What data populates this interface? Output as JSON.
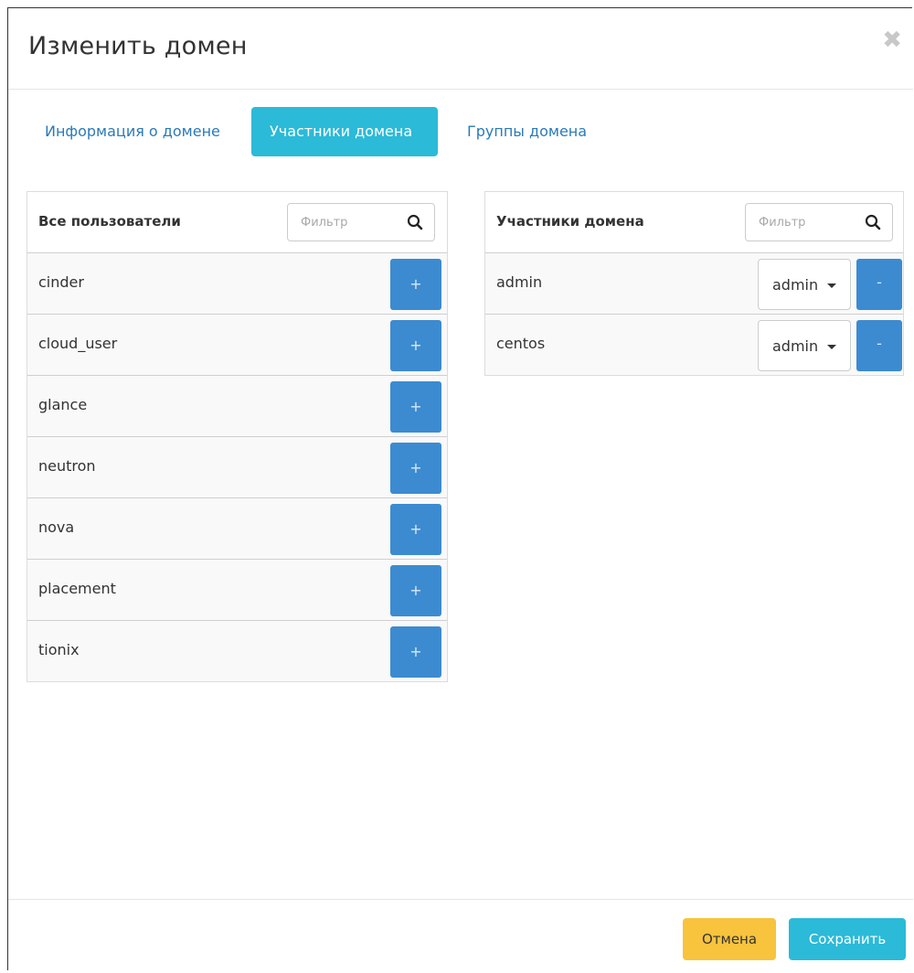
{
  "modal": {
    "title": "Изменить домен",
    "close_icon": "close-icon"
  },
  "tabs": [
    {
      "label": "Информация о домене",
      "active": false
    },
    {
      "label": "Участники домена",
      "active": true
    },
    {
      "label": "Группы домена",
      "active": false
    }
  ],
  "all_users": {
    "title": "Все пользователи",
    "filter_placeholder": "Фильтр",
    "add_label": "+",
    "items": [
      "cinder",
      "cloud_user",
      "glance",
      "neutron",
      "nova",
      "placement",
      "tionix"
    ]
  },
  "members": {
    "title": "Участники домена",
    "filter_placeholder": "Фильтр",
    "remove_label": "-",
    "items": [
      {
        "name": "admin",
        "role": "admin"
      },
      {
        "name": "centos",
        "role": "admin"
      }
    ]
  },
  "footer": {
    "cancel_label": "Отмена",
    "save_label": "Сохранить"
  },
  "colors": {
    "accent": "#2bbad8",
    "primary": "#3c8bd0",
    "warning": "#f8c33d",
    "link": "#2a7ab8"
  }
}
